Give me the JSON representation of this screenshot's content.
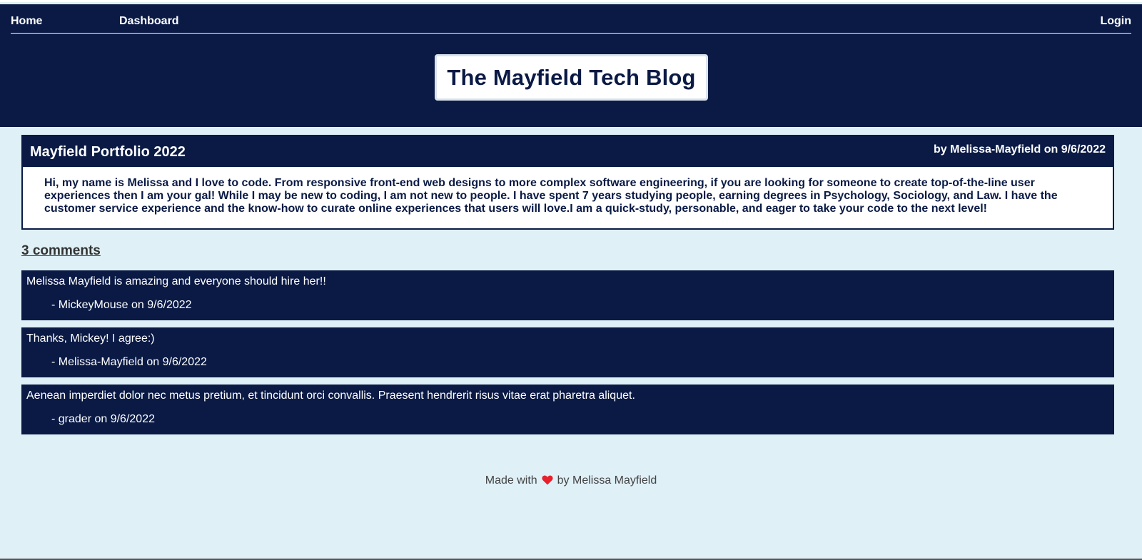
{
  "nav": {
    "home": "Home",
    "dashboard": "Dashboard",
    "login": "Login"
  },
  "site_title": "The Mayfield Tech Blog",
  "post": {
    "title": "Mayfield Portfolio 2022",
    "byline": "by Melissa-Mayfield on 9/6/2022",
    "body": "Hi, my name is Melissa and I love to code. From responsive front-end web designs to more complex software engineering, if you are looking for someone to create top-of-the-line user experiences then I am your gal! While I may be new to coding, I am not new to people. I have spent 7 years studying people, earning degrees in Psychology, Sociology, and Law. I have the customer service experience and the know-how to curate online experiences that users will love.I am a quick-study, personable, and eager to take your code to the next level!"
  },
  "comments_count": "3 comments",
  "comments": [
    {
      "text": "Melissa Mayfield is amazing and everyone should hire her!!",
      "meta": "- MickeyMouse on 9/6/2022"
    },
    {
      "text": "Thanks, Mickey! I agree:)",
      "meta": "- Melissa-Mayfield on 9/6/2022"
    },
    {
      "text": "Aenean imperdiet dolor nec metus pretium, et tincidunt orci convallis. Praesent hendrerit risus vitae erat pharetra aliquet.",
      "meta": "- grader on 9/6/2022"
    }
  ],
  "footer": {
    "prefix": "Made with",
    "icon": "heart-icon",
    "suffix": "by Melissa Mayfield"
  },
  "colors": {
    "navy": "#0a1a45",
    "background": "#dff0f7",
    "heart": "#e8202c"
  }
}
